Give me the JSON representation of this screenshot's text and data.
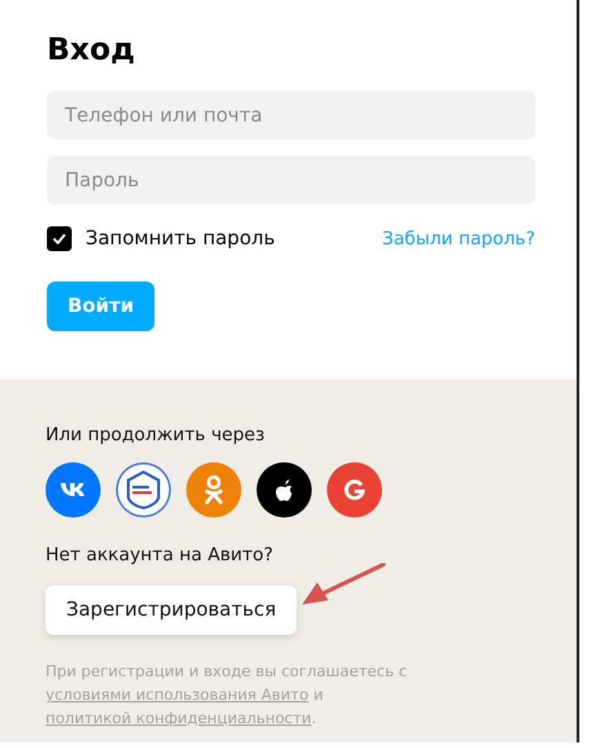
{
  "title": "Вход",
  "fields": [
    {
      "placeholder": "Телефон или почта"
    },
    {
      "placeholder": "Пароль"
    }
  ],
  "remember": {
    "label": "Запомнить пароль",
    "checked": true
  },
  "forgot_link": "Забыли пароль?",
  "login_button": "Войти",
  "social_heading": "Или продолжить через",
  "social": [
    {
      "kind": "vk",
      "color": "#0077ff"
    },
    {
      "kind": "gosuslugi",
      "color": "#ffffff"
    },
    {
      "kind": "ok",
      "color": "#ee8208"
    },
    {
      "kind": "apple",
      "color": "#000000"
    },
    {
      "kind": "google",
      "color": "#ea4335"
    }
  ],
  "no_account": "Нет аккаунта на Авито?",
  "register_button": "Зарегистрироваться",
  "legal": [
    {
      "kind": "text",
      "text": "При регистрации и входе вы соглашаетесь с "
    },
    {
      "kind": "link",
      "text": "условиями использования Авито"
    },
    {
      "kind": "text",
      "text": " и "
    },
    {
      "kind": "link",
      "text": "политикой конфиденциальности"
    },
    {
      "kind": "text",
      "text": "."
    }
  ]
}
